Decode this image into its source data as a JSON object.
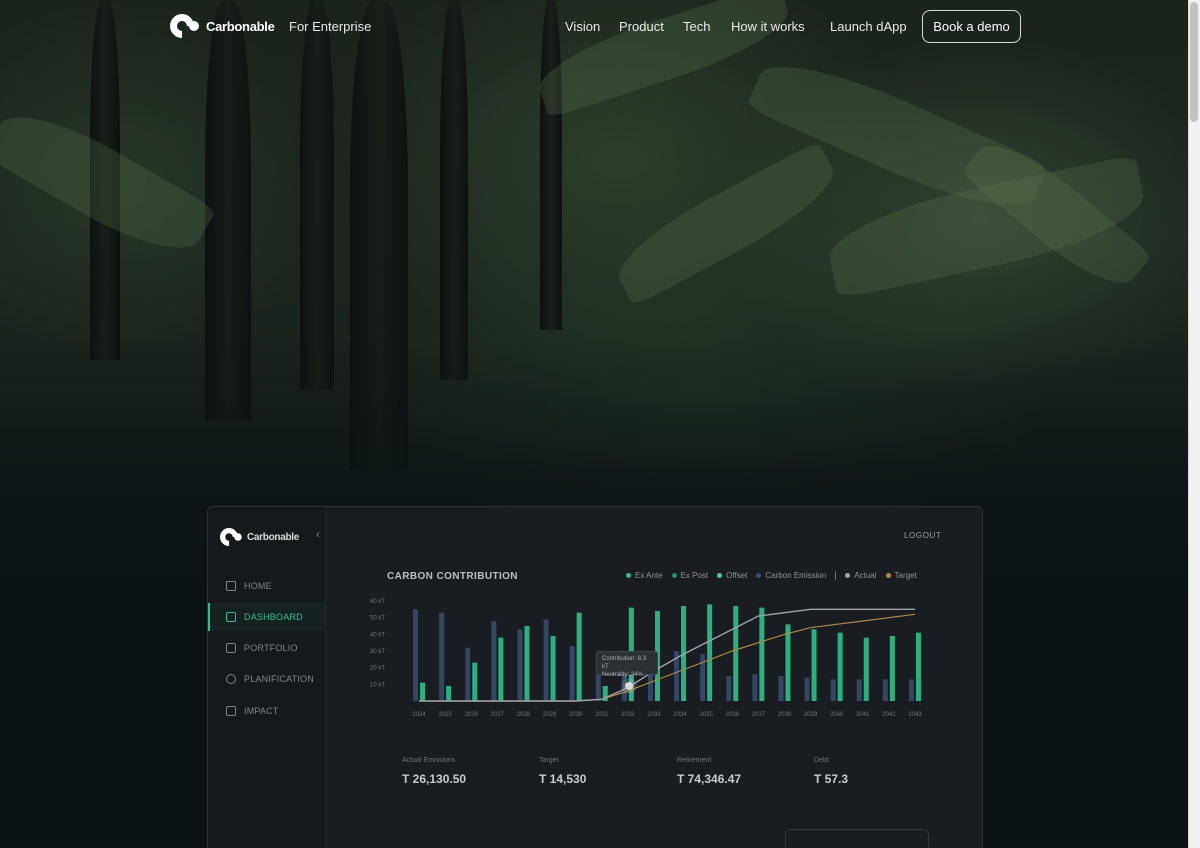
{
  "nav": {
    "brand": "Carbonable",
    "enterprise": "For Enterprise",
    "links": [
      "Vision",
      "Product",
      "Tech",
      "How it works",
      "Launch dApp"
    ],
    "cta": "Book a demo"
  },
  "dashboard": {
    "brand": "Carbonable",
    "logout": "LOGOUT",
    "sidebar": [
      "HOME",
      "DASHBOARD",
      "PORTFOLIO",
      "PLANIFICATION",
      "IMPACT"
    ],
    "active_item": "DASHBOARD",
    "panel_title": "CARBON CONTRIBUTION",
    "legend": [
      "Ex Ante",
      "Ex Post",
      "Offset",
      "Carbon Emission",
      "Actual",
      "Target"
    ],
    "tooltip": {
      "line1": "Contribution: 8.3 kT",
      "line2": "Neutrality: 34%"
    },
    "stats": [
      {
        "label": "Actual Emissions",
        "value": "T 26,130.50"
      },
      {
        "label": "Target",
        "value": "T 14,530"
      },
      {
        "label": "Retirement",
        "value": "T 74,346.47"
      },
      {
        "label": "Debt",
        "value": "T 57.3"
      }
    ]
  },
  "colors": {
    "accent": "#2ec28a",
    "emission_bar": "#3a4e6e",
    "target_line": "#b08a3a",
    "actual_line": "#9ea4a8"
  },
  "chart_data": {
    "type": "bar",
    "title": "CARBON CONTRIBUTION",
    "y_ticks": [
      "60 kT",
      "50 kT",
      "40 kT",
      "30 kT",
      "20 kT",
      "10 kT"
    ],
    "ylim": [
      0,
      60
    ],
    "categories": [
      "2024",
      "2025",
      "2026",
      "2027",
      "2028",
      "2029",
      "2030",
      "2031",
      "2032",
      "2033",
      "2034",
      "2035",
      "2036",
      "2037",
      "2038",
      "2039",
      "2040",
      "2041",
      "2042",
      "2043"
    ],
    "series": [
      {
        "name": "Carbon Emission",
        "values": [
          55,
          53,
          32,
          48,
          43,
          49,
          33,
          29,
          18,
          16,
          30,
          28,
          15,
          16,
          15,
          14,
          13,
          13,
          13,
          13
        ]
      },
      {
        "name": "Offset",
        "values": [
          11,
          9,
          23,
          38,
          45,
          39,
          53,
          9,
          56,
          54,
          57,
          58,
          57,
          56,
          46,
          43,
          41,
          38,
          39,
          41
        ]
      },
      {
        "name": "Actual",
        "values": [
          0,
          0,
          0,
          0,
          0,
          0,
          0,
          1,
          8,
          18,
          27,
          35,
          43,
          51,
          53,
          55,
          55,
          55,
          55,
          55
        ]
      },
      {
        "name": "Target",
        "values": [
          0,
          0,
          0,
          0,
          0,
          0,
          0,
          1,
          6,
          12,
          18,
          24,
          30,
          35,
          40,
          44,
          46,
          48,
          50,
          52
        ]
      }
    ]
  }
}
